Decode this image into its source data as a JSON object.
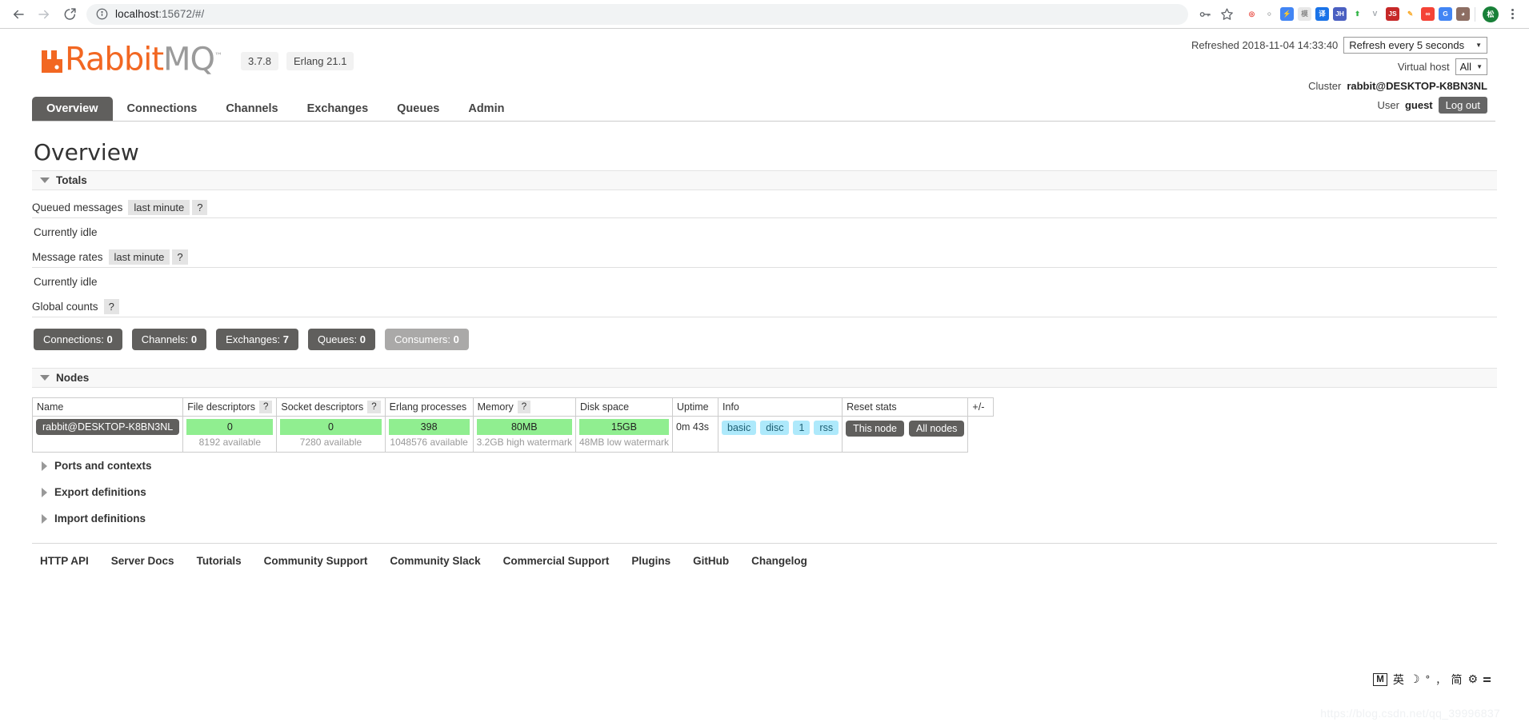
{
  "browser": {
    "url_host": "localhost",
    "url_rest": ":15672/#/",
    "back_icon": "back-arrow-icon",
    "forward_icon": "forward-arrow-icon",
    "reload_icon": "reload-icon",
    "info_icon": "site-info-icon",
    "extensions": [
      {
        "name": "adblock-extension",
        "glyph": "◎",
        "color": "#e8453c",
        "text_color": "#e8453c",
        "bg": "#ffffff"
      },
      {
        "name": "shield-extension",
        "glyph": "○",
        "color": "#3c4043",
        "text_color": "#3c4043",
        "bg": "#ffffff"
      },
      {
        "name": "lightning-extension",
        "glyph": "⚡",
        "color": "#ffffff",
        "text_color": "#ffffff",
        "bg": "#4285f4"
      },
      {
        "name": "grayscale-extension",
        "glyph": "模",
        "color": "#888888",
        "text_color": "#888888",
        "bg": "#e8e8e8"
      },
      {
        "name": "translate-cn-extension",
        "glyph": "译",
        "color": "#ffffff",
        "text_color": "#ffffff",
        "bg": "#1a73e8"
      },
      {
        "name": "jh-extension",
        "glyph": "JH",
        "color": "#ffffff",
        "text_color": "#ffffff",
        "bg": "#4a5fc1"
      },
      {
        "name": "green-arrow-extension",
        "glyph": "⬆",
        "color": "#2fb344",
        "text_color": "#2fb344",
        "bg": "#ffffff"
      },
      {
        "name": "vimium-extension",
        "glyph": "V",
        "color": "#9aa0a6",
        "text_color": "#9aa0a6",
        "bg": "#ffffff"
      },
      {
        "name": "js-extension",
        "glyph": "JS",
        "color": "#ffffff",
        "text_color": "#ffffff",
        "bg": "#c62828"
      },
      {
        "name": "marker-extension",
        "glyph": "✎",
        "color": "#f9a825",
        "text_color": "#f9a825",
        "bg": "#ffffff"
      },
      {
        "name": "infinity-extension",
        "glyph": "∞",
        "color": "#ffffff",
        "text_color": "#ffffff",
        "bg": "#f44336"
      },
      {
        "name": "google-translate-extension",
        "glyph": "G",
        "color": "#ffffff",
        "text_color": "#ffffff",
        "bg": "#4285f4"
      },
      {
        "name": "user-photo-extension",
        "glyph": "◕",
        "color": "#ffffff",
        "text_color": "#ffffff",
        "bg": "#8d6e63"
      }
    ],
    "key_icon": "password-key-icon",
    "star_icon": "bookmark-star-icon",
    "profile_initial": "松",
    "menu_icon": "browser-menu-icon"
  },
  "header": {
    "logo_rabbit": "Rabbit",
    "logo_mq": "MQ",
    "logo_tm": "™",
    "version": "3.7.8",
    "erlang": "Erlang 21.1",
    "refreshed_label": "Refreshed 2018-11-04 14:33:40",
    "refresh_select": "Refresh every 5 seconds",
    "vhost_label": "Virtual host",
    "vhost_select": "All",
    "cluster_label": "Cluster",
    "cluster_name": "rabbit@DESKTOP-K8BN3NL",
    "user_label": "User",
    "user_name": "guest",
    "logout_label": "Log out"
  },
  "tabs": [
    {
      "label": "Overview",
      "active": true
    },
    {
      "label": "Connections",
      "active": false
    },
    {
      "label": "Channels",
      "active": false
    },
    {
      "label": "Exchanges",
      "active": false
    },
    {
      "label": "Queues",
      "active": false
    },
    {
      "label": "Admin",
      "active": false
    }
  ],
  "main": {
    "page_title": "Overview",
    "totals_header": "Totals",
    "queued_messages_label": "Queued messages",
    "queued_messages_period": "last minute",
    "queued_messages_idle": "Currently idle",
    "message_rates_label": "Message rates",
    "message_rates_period": "last minute",
    "message_rates_idle": "Currently idle",
    "global_counts_label": "Global counts",
    "help_mark": "?",
    "counts": [
      {
        "label": "Connections:",
        "value": "0",
        "muted": false
      },
      {
        "label": "Channels:",
        "value": "0",
        "muted": false
      },
      {
        "label": "Exchanges:",
        "value": "7",
        "muted": false
      },
      {
        "label": "Queues:",
        "value": "0",
        "muted": false
      },
      {
        "label": "Consumers:",
        "value": "0",
        "muted": true
      }
    ]
  },
  "nodes": {
    "header": "Nodes",
    "columns": [
      {
        "label": "Name",
        "help": false
      },
      {
        "label": "File descriptors",
        "help": true
      },
      {
        "label": "Socket descriptors",
        "help": true
      },
      {
        "label": "Erlang processes",
        "help": false
      },
      {
        "label": "Memory",
        "help": true
      },
      {
        "label": "Disk space",
        "help": false
      },
      {
        "label": "Uptime",
        "help": false
      },
      {
        "label": "Info",
        "help": false
      },
      {
        "label": "Reset stats",
        "help": false
      }
    ],
    "plus_minus": "+/-",
    "row": {
      "name": "rabbit@DESKTOP-K8BN3NL",
      "file_descriptors": "0",
      "file_descriptors_note": "8192 available",
      "socket_descriptors": "0",
      "socket_descriptors_note": "7280 available",
      "erlang_processes": "398",
      "erlang_processes_note": "1048576 available",
      "memory": "80MB",
      "memory_note": "3.2GB high watermark",
      "disk_space": "15GB",
      "disk_space_note": "48MB low watermark",
      "uptime": "0m 43s",
      "info_badges": [
        "basic",
        "disc",
        "1",
        "rss"
      ],
      "reset_buttons": [
        "This node",
        "All nodes"
      ]
    }
  },
  "collapsed_sections": [
    {
      "label": "Ports and contexts"
    },
    {
      "label": "Export definitions"
    },
    {
      "label": "Import definitions"
    }
  ],
  "footer_links": [
    "HTTP API",
    "Server Docs",
    "Tutorials",
    "Community Support",
    "Community Slack",
    "Commercial Support",
    "Plugins",
    "GitHub",
    "Changelog"
  ],
  "ime": {
    "mode": "M",
    "lang": "英",
    "moon": "☽",
    "degree": "°",
    "comma": "，",
    "simplified": "简",
    "gear": "⚙",
    "handle_icon": "drag-handle-icon"
  },
  "watermark": "https://blog.csdn.net/qq_39996837",
  "colors": {
    "brand_orange": "#f26722",
    "dark_gray": "#605f5d",
    "muted_gray": "#aaa9a8",
    "green_bar": "#90ee90",
    "info_blue": "#aee9fb"
  }
}
